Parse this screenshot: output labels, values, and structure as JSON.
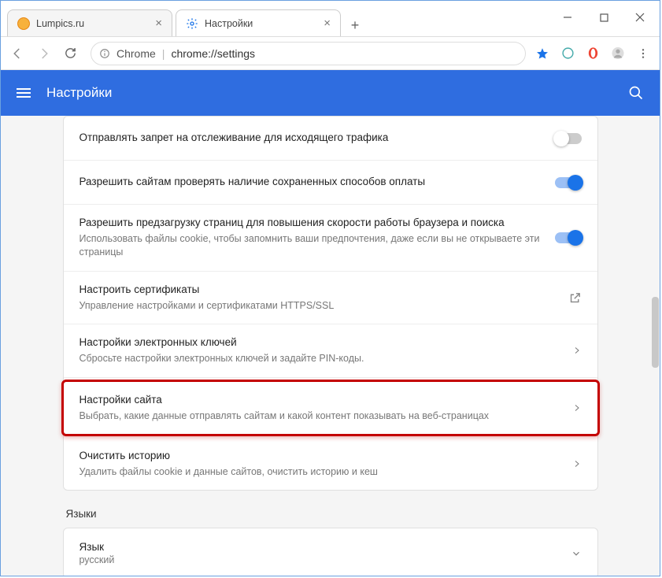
{
  "window": {
    "tabs": [
      {
        "title": "Lumpics.ru",
        "favicon_color": "#f5a623",
        "active": false
      },
      {
        "title": "Настройки",
        "favicon_color": "#1a73e8",
        "active": true,
        "is_settings": true
      }
    ]
  },
  "addressbar": {
    "origin_label": "Chrome",
    "path": "chrome://settings"
  },
  "header": {
    "title": "Настройки"
  },
  "settings_rows": [
    {
      "id": "do-not-track",
      "title": "Отправлять запрет на отслеживание для исходящего трафика",
      "sub": "",
      "action": "toggle",
      "toggle_on": false
    },
    {
      "id": "payment-methods",
      "title": "Разрешить сайтам проверять наличие сохраненных способов оплаты",
      "sub": "",
      "action": "toggle",
      "toggle_on": true
    },
    {
      "id": "preload",
      "title": "Разрешить предзагрузку страниц для повышения скорости работы браузера и поиска",
      "sub": "Использовать файлы cookie, чтобы запомнить ваши предпочтения, даже если вы не открываете эти страницы",
      "action": "toggle",
      "toggle_on": true
    },
    {
      "id": "certificates",
      "title": "Настроить сертификаты",
      "sub": "Управление настройками и сертификатами HTTPS/SSL",
      "action": "external"
    },
    {
      "id": "security-keys",
      "title": "Настройки электронных ключей",
      "sub": "Сбросьте настройки электронных ключей и задайте PIN-коды.",
      "action": "arrow"
    },
    {
      "id": "site-settings",
      "title": "Настройки сайта",
      "sub": "Выбрать, какие данные отправлять сайтам и какой контент показывать на веб-страницах",
      "action": "arrow",
      "highlighted": true
    },
    {
      "id": "clear-history",
      "title": "Очистить историю",
      "sub": "Удалить файлы cookie и данные сайтов, очистить историю и кеш",
      "action": "arrow"
    }
  ],
  "languages": {
    "section_label": "Языки",
    "title": "Язык",
    "value": "русский"
  }
}
